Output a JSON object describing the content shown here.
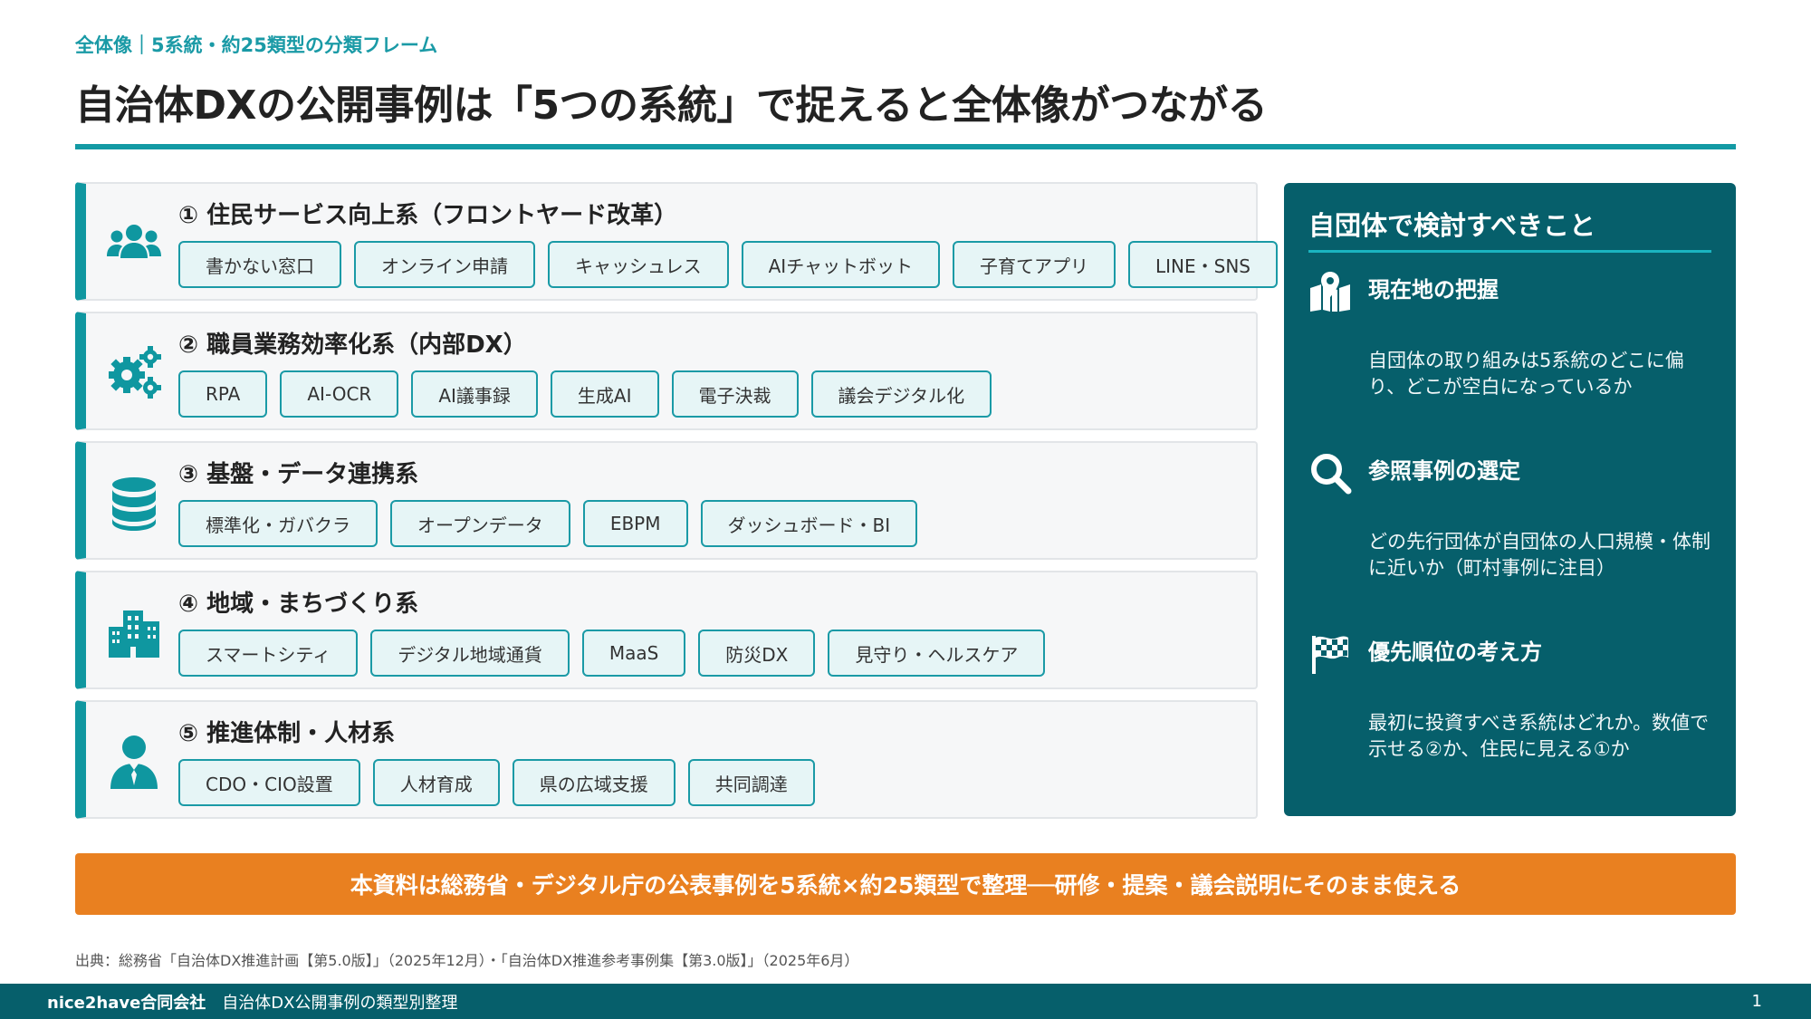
{
  "header": {
    "eyebrow": "全体像｜5系統・約25類型の分類フレーム",
    "title": "自治体DXの公開事例は「5つの系統」で捉えると全体像がつながる",
    "accent_color": "#139aa4"
  },
  "categories": [
    {
      "title": "① 住民サービス向上系（フロントヤード改革）",
      "icon": "people-group-icon",
      "tags": [
        "書かない窓口",
        "オンライン申請",
        "キャッシュレス",
        "AIチャットボット",
        "子育てアプリ",
        "LINE・SNS"
      ]
    },
    {
      "title": "② 職員業務効率化系（内部DX）",
      "icon": "gears-icon",
      "tags": [
        "RPA",
        "AI-OCR",
        "AI議事録",
        "生成AI",
        "電子決裁",
        "議会デジタル化"
      ]
    },
    {
      "title": "③ 基盤・データ連携系",
      "icon": "database-icon",
      "tags": [
        "標準化・ガバクラ",
        "オープンデータ",
        "EBPM",
        "ダッシュボード・BI"
      ]
    },
    {
      "title": "④ 地域・まちづくり系",
      "icon": "city-icon",
      "tags": [
        "スマートシティ",
        "デジタル地域通貨",
        "MaaS",
        "防災DX",
        "見守り・ヘルスケア"
      ]
    },
    {
      "title": "⑤ 推進体制・人材系",
      "icon": "person-tie-icon",
      "tags": [
        "CDO・CIO設置",
        "人材育成",
        "県の広域支援",
        "共同調達"
      ]
    }
  ],
  "side_panel": {
    "title": "自団体で検討すべきこと",
    "background_color": "#065f6b",
    "items": [
      {
        "icon": "map-pin-icon",
        "heading": "現在地の把握",
        "body": "自団体の取り組みは5系統のどこに偏り、どこが空白になっているか"
      },
      {
        "icon": "magnifier-icon",
        "heading": "参照事例の選定",
        "body": "どの先行団体が自団体の人口規模・体制に近いか（町村事例に注目）"
      },
      {
        "icon": "checkered-flag-icon",
        "heading": "優先順位の考え方",
        "body": "最初に投資すべき系統はどれか。数値で示せる②か、住民に見える①か"
      }
    ]
  },
  "banner": {
    "text": "本資料は総務省・デジタル庁の公表事例を5系統×約25類型で整理──研修・提案・議会説明にそのまま使える",
    "color": "#e98020"
  },
  "source": "出典：総務省「自治体DX推進計画【第5.0版】」（2025年12月）・「自治体DX推進参考事例集【第3.0版】」（2025年6月）",
  "footer": {
    "company": "nice2have合同会社",
    "doc_name": "自治体DX公開事例の類型別整理",
    "page": "1"
  }
}
